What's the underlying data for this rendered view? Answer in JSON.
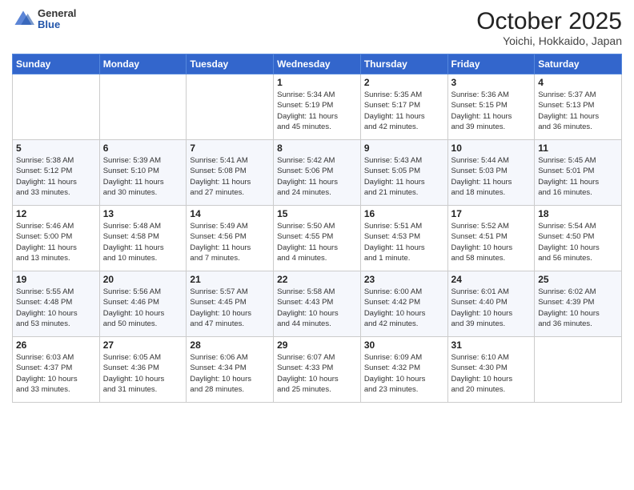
{
  "header": {
    "logo": {
      "general": "General",
      "blue": "Blue"
    },
    "month": "October 2025",
    "location": "Yoichi, Hokkaido, Japan"
  },
  "weekdays": [
    "Sunday",
    "Monday",
    "Tuesday",
    "Wednesday",
    "Thursday",
    "Friday",
    "Saturday"
  ],
  "weeks": [
    [
      {
        "day": "",
        "info": ""
      },
      {
        "day": "",
        "info": ""
      },
      {
        "day": "",
        "info": ""
      },
      {
        "day": "1",
        "info": "Sunrise: 5:34 AM\nSunset: 5:19 PM\nDaylight: 11 hours\nand 45 minutes."
      },
      {
        "day": "2",
        "info": "Sunrise: 5:35 AM\nSunset: 5:17 PM\nDaylight: 11 hours\nand 42 minutes."
      },
      {
        "day": "3",
        "info": "Sunrise: 5:36 AM\nSunset: 5:15 PM\nDaylight: 11 hours\nand 39 minutes."
      },
      {
        "day": "4",
        "info": "Sunrise: 5:37 AM\nSunset: 5:13 PM\nDaylight: 11 hours\nand 36 minutes."
      }
    ],
    [
      {
        "day": "5",
        "info": "Sunrise: 5:38 AM\nSunset: 5:12 PM\nDaylight: 11 hours\nand 33 minutes."
      },
      {
        "day": "6",
        "info": "Sunrise: 5:39 AM\nSunset: 5:10 PM\nDaylight: 11 hours\nand 30 minutes."
      },
      {
        "day": "7",
        "info": "Sunrise: 5:41 AM\nSunset: 5:08 PM\nDaylight: 11 hours\nand 27 minutes."
      },
      {
        "day": "8",
        "info": "Sunrise: 5:42 AM\nSunset: 5:06 PM\nDaylight: 11 hours\nand 24 minutes."
      },
      {
        "day": "9",
        "info": "Sunrise: 5:43 AM\nSunset: 5:05 PM\nDaylight: 11 hours\nand 21 minutes."
      },
      {
        "day": "10",
        "info": "Sunrise: 5:44 AM\nSunset: 5:03 PM\nDaylight: 11 hours\nand 18 minutes."
      },
      {
        "day": "11",
        "info": "Sunrise: 5:45 AM\nSunset: 5:01 PM\nDaylight: 11 hours\nand 16 minutes."
      }
    ],
    [
      {
        "day": "12",
        "info": "Sunrise: 5:46 AM\nSunset: 5:00 PM\nDaylight: 11 hours\nand 13 minutes."
      },
      {
        "day": "13",
        "info": "Sunrise: 5:48 AM\nSunset: 4:58 PM\nDaylight: 11 hours\nand 10 minutes."
      },
      {
        "day": "14",
        "info": "Sunrise: 5:49 AM\nSunset: 4:56 PM\nDaylight: 11 hours\nand 7 minutes."
      },
      {
        "day": "15",
        "info": "Sunrise: 5:50 AM\nSunset: 4:55 PM\nDaylight: 11 hours\nand 4 minutes."
      },
      {
        "day": "16",
        "info": "Sunrise: 5:51 AM\nSunset: 4:53 PM\nDaylight: 11 hours\nand 1 minute."
      },
      {
        "day": "17",
        "info": "Sunrise: 5:52 AM\nSunset: 4:51 PM\nDaylight: 10 hours\nand 58 minutes."
      },
      {
        "day": "18",
        "info": "Sunrise: 5:54 AM\nSunset: 4:50 PM\nDaylight: 10 hours\nand 56 minutes."
      }
    ],
    [
      {
        "day": "19",
        "info": "Sunrise: 5:55 AM\nSunset: 4:48 PM\nDaylight: 10 hours\nand 53 minutes."
      },
      {
        "day": "20",
        "info": "Sunrise: 5:56 AM\nSunset: 4:46 PM\nDaylight: 10 hours\nand 50 minutes."
      },
      {
        "day": "21",
        "info": "Sunrise: 5:57 AM\nSunset: 4:45 PM\nDaylight: 10 hours\nand 47 minutes."
      },
      {
        "day": "22",
        "info": "Sunrise: 5:58 AM\nSunset: 4:43 PM\nDaylight: 10 hours\nand 44 minutes."
      },
      {
        "day": "23",
        "info": "Sunrise: 6:00 AM\nSunset: 4:42 PM\nDaylight: 10 hours\nand 42 minutes."
      },
      {
        "day": "24",
        "info": "Sunrise: 6:01 AM\nSunset: 4:40 PM\nDaylight: 10 hours\nand 39 minutes."
      },
      {
        "day": "25",
        "info": "Sunrise: 6:02 AM\nSunset: 4:39 PM\nDaylight: 10 hours\nand 36 minutes."
      }
    ],
    [
      {
        "day": "26",
        "info": "Sunrise: 6:03 AM\nSunset: 4:37 PM\nDaylight: 10 hours\nand 33 minutes."
      },
      {
        "day": "27",
        "info": "Sunrise: 6:05 AM\nSunset: 4:36 PM\nDaylight: 10 hours\nand 31 minutes."
      },
      {
        "day": "28",
        "info": "Sunrise: 6:06 AM\nSunset: 4:34 PM\nDaylight: 10 hours\nand 28 minutes."
      },
      {
        "day": "29",
        "info": "Sunrise: 6:07 AM\nSunset: 4:33 PM\nDaylight: 10 hours\nand 25 minutes."
      },
      {
        "day": "30",
        "info": "Sunrise: 6:09 AM\nSunset: 4:32 PM\nDaylight: 10 hours\nand 23 minutes."
      },
      {
        "day": "31",
        "info": "Sunrise: 6:10 AM\nSunset: 4:30 PM\nDaylight: 10 hours\nand 20 minutes."
      },
      {
        "day": "",
        "info": ""
      }
    ]
  ]
}
